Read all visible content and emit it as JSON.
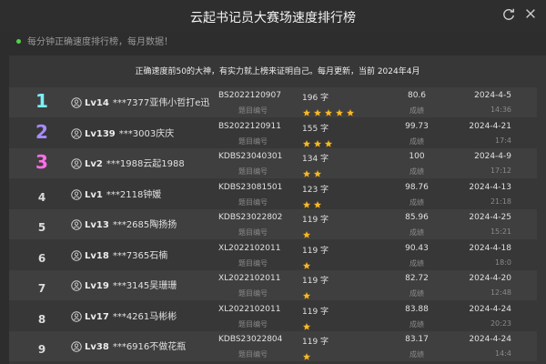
{
  "window": {
    "title": "云起书记员大赛场速度排行榜",
    "subtitle": "每分钟正确速度排行榜，每月数据！"
  },
  "colors": {
    "rank_1": "#7cf0ff",
    "rank_2": "#a98bff",
    "rank_3": "#ff6ee8",
    "star": "#f5b82e",
    "status_dot": "#51d34b"
  },
  "notice": "正确速度前50的大神，有实力就上榜来证明自己。每月更新，当前 2024年4月",
  "labels": {
    "code_label": "题目编号",
    "score_label": "成绩"
  },
  "rows": [
    {
      "rank": "1",
      "level": "Lv14",
      "name": "***7377亚伟小哲打e迅",
      "code": "BS2022120907",
      "chars": "196 字",
      "stars": 5,
      "score": "80.6",
      "date": "2024-4-5",
      "time": "14:36"
    },
    {
      "rank": "2",
      "level": "Lv139",
      "name": "***3003庆庆",
      "code": "BS2022120911",
      "chars": "155 字",
      "stars": 3,
      "score": "99.73",
      "date": "2024-4-21",
      "time": "17:4"
    },
    {
      "rank": "3",
      "level": "Lv2",
      "name": "***1988云起1988",
      "code": "KDBS23040301",
      "chars": "134 字",
      "stars": 2,
      "score": "100",
      "date": "2024-4-9",
      "time": "17:12"
    },
    {
      "rank": "4",
      "level": "Lv1",
      "name": "***2118钟媛",
      "code": "KDBS23081501",
      "chars": "123 字",
      "stars": 2,
      "score": "98.76",
      "date": "2024-4-13",
      "time": "21:18"
    },
    {
      "rank": "5",
      "level": "Lv13",
      "name": "***2685陶扬扬",
      "code": "KDBS23022802",
      "chars": "119 字",
      "stars": 1,
      "score": "85.96",
      "date": "2024-4-25",
      "time": "15:21"
    },
    {
      "rank": "6",
      "level": "Lv18",
      "name": "***7365石楠",
      "code": "XL2022102011",
      "chars": "119 字",
      "stars": 1,
      "score": "90.43",
      "date": "2024-4-18",
      "time": "18:0"
    },
    {
      "rank": "7",
      "level": "Lv19",
      "name": "***3145吴珊珊",
      "code": "XL2022102011",
      "chars": "119 字",
      "stars": 1,
      "score": "82.72",
      "date": "2024-4-20",
      "time": "12:48"
    },
    {
      "rank": "8",
      "level": "Lv17",
      "name": "***4261马彬彬",
      "code": "XL2022102011",
      "chars": "119 字",
      "stars": 1,
      "score": "83.88",
      "date": "2024-4-24",
      "time": "20:23"
    },
    {
      "rank": "9",
      "level": "Lv38",
      "name": "***6916不做花瓶",
      "code": "KDBS23022804",
      "chars": "119 字",
      "stars": 1,
      "score": "83.17",
      "date": "2024-4-24",
      "time": "14:4"
    }
  ]
}
